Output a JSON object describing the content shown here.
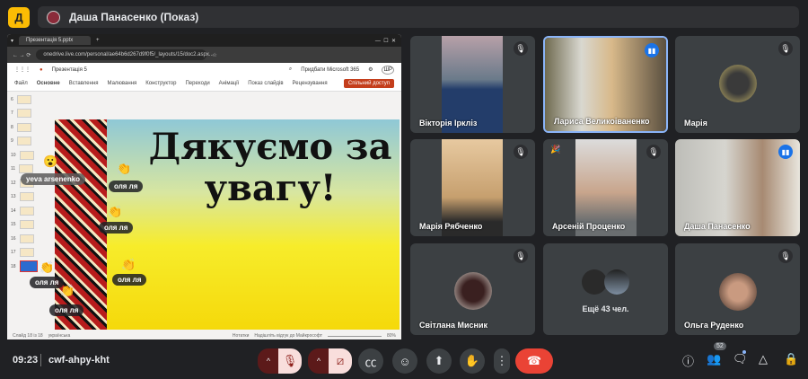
{
  "header": {
    "logo_text": "Д",
    "presenter": "Даша Панасенко (Показ)"
  },
  "browser": {
    "tab_title": "Презентація 5.pptx",
    "url": "onedrive.live.com/personal/ae64b6d267d9f0f5/_layouts/15/doc2.aspx..."
  },
  "powerpoint": {
    "file_name": "Презентація 5",
    "buy": "Придбати Microsoft 365",
    "user_initials": "ШР",
    "ribbon": [
      "Файл",
      "Основне",
      "Вставлення",
      "Малювання",
      "Конструктор",
      "Переходи",
      "Анімації",
      "Показ слайдів",
      "Рецензування"
    ],
    "share_label": "Спільний доступ",
    "slide_numbers": [
      "6",
      "7",
      "8",
      "9",
      "10",
      "11",
      "12",
      "13",
      "14",
      "15",
      "16",
      "17",
      "18"
    ],
    "slide_title": "Дякуємо за увагу!",
    "status_left": "Слайд 18 із 18",
    "language": "українська",
    "notes": "Нотатки",
    "feedback": "Надішліть відгук до Майкрософт",
    "zoom": "80%"
  },
  "reactions": [
    {
      "emoji": "😮",
      "name": "yeva arsenenko"
    },
    {
      "emoji": "👏",
      "name": "оля ля"
    },
    {
      "emoji": "👏",
      "name": "оля ля"
    },
    {
      "emoji": "👏",
      "name": "оля ля"
    },
    {
      "emoji": "👏",
      "name": "оля ля"
    },
    {
      "emoji": "👏",
      "name": "оля ля"
    }
  ],
  "participants": [
    {
      "name": "Вікторія Іркліз",
      "state": "muted"
    },
    {
      "name": "Лариса Великоіваненко",
      "state": "speaking"
    },
    {
      "name": "Марія",
      "state": "muted"
    },
    {
      "name": "Марія Рябченко",
      "state": "muted"
    },
    {
      "name": "Арсеній Проценко",
      "state": "muted"
    },
    {
      "name": "Даша Панасенко",
      "state": "speaking"
    },
    {
      "name": "Світлана Мисник",
      "state": "muted"
    },
    {
      "name": "Ещё 43 чел.",
      "state": "group"
    },
    {
      "name": "Ольга Руденко",
      "state": "muted"
    }
  ],
  "footer": {
    "time": "09:23",
    "meeting_code": "cwf-ahpy-kht",
    "people_count": "52"
  },
  "colors": {
    "accent": "#1a73e8",
    "end_call": "#ea4335",
    "muted_bg": "#f9dedc"
  }
}
